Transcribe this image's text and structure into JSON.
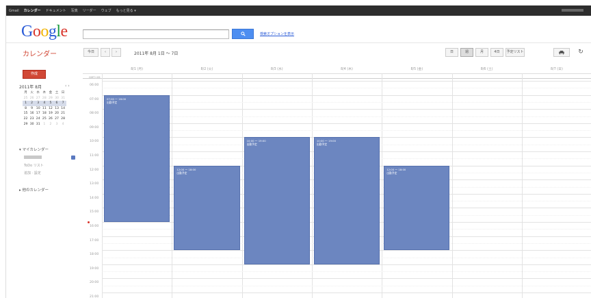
{
  "gbar": {
    "items": [
      "Gmail",
      "カレンダー",
      "ドキュメント",
      "写真",
      "リーダー",
      "ウェブ",
      "もっと見る ▾"
    ],
    "active_index": 1
  },
  "header": {
    "logo": [
      "G",
      "o",
      "o",
      "g",
      "l",
      "e"
    ],
    "search_placeholder": "",
    "search_button_icon": "search-icon",
    "search_options_link": "検索オプションを表示"
  },
  "toolbar": {
    "app_title": "カレンダー",
    "today_label": "今日",
    "prev_label": "‹",
    "next_label": "›",
    "date_range": "2011年 8月 1日 ～ 7日",
    "views": [
      "日",
      "週",
      "月",
      "4日",
      "予定リスト"
    ],
    "selected_view_index": 1,
    "print_icon": "print-icon",
    "refresh_icon": "refresh-icon"
  },
  "sidebar": {
    "create_label": "作成",
    "mini_cal_title": "2011年 8月",
    "mini_nav": "‹  ›",
    "weekdays": [
      "月",
      "火",
      "水",
      "木",
      "金",
      "土",
      "日"
    ],
    "weeks": [
      [
        "25",
        "26",
        "27",
        "28",
        "29",
        "30",
        "31"
      ],
      [
        "1",
        "2",
        "3",
        "4",
        "5",
        "6",
        "7"
      ],
      [
        "8",
        "9",
        "10",
        "11",
        "12",
        "13",
        "14"
      ],
      [
        "15",
        "16",
        "17",
        "18",
        "19",
        "20",
        "21"
      ],
      [
        "22",
        "23",
        "24",
        "25",
        "26",
        "27",
        "28"
      ],
      [
        "29",
        "30",
        "31",
        "1",
        "2",
        "3",
        "4"
      ]
    ],
    "my_calendars_label": "▾ マイカレンダー",
    "calendar_items": [
      "ToDo リスト",
      "追加 · 設定"
    ],
    "other_calendars_label": "▸ 他のカレンダー",
    "colors": {
      "calendar_swatch": "#5a79c0"
    }
  },
  "grid": {
    "timezone": "GMT+09",
    "days": [
      "8/1 (月)",
      "8/2 (火)",
      "8/3 (水)",
      "8/4 (木)",
      "8/5 (金)",
      "8/6 (土)",
      "8/7 (日)"
    ],
    "hours": [
      "06:00",
      "07:00",
      "08:00",
      "09:00",
      "10:00",
      "11:00",
      "12:00",
      "13:00",
      "14:00",
      "15:00",
      "16:00",
      "17:00",
      "18:00",
      "19:00",
      "20:00",
      "21:00"
    ],
    "events": [
      {
        "day": 0,
        "start": 7.0,
        "end": 16.0,
        "time": "07:00 ～ 16:00",
        "title": "出勤予定"
      },
      {
        "day": 1,
        "start": 12.0,
        "end": 18.0,
        "time": "12:00 ～ 18:00",
        "title": "出勤予定"
      },
      {
        "day": 2,
        "start": 10.0,
        "end": 19.0,
        "time": "10:00 ～ 19:00",
        "title": "出勤予定"
      },
      {
        "day": 3,
        "start": 10.0,
        "end": 19.0,
        "time": "10:00 ～ 19:00",
        "title": "出勤予定"
      },
      {
        "day": 4,
        "start": 12.0,
        "end": 18.0,
        "time": "12:00 ～ 18:00",
        "title": "出勤予定"
      }
    ],
    "now_hour": 16.0,
    "colors": {
      "event_bg": "#6c86c0",
      "event_border": "#5570ad"
    }
  }
}
